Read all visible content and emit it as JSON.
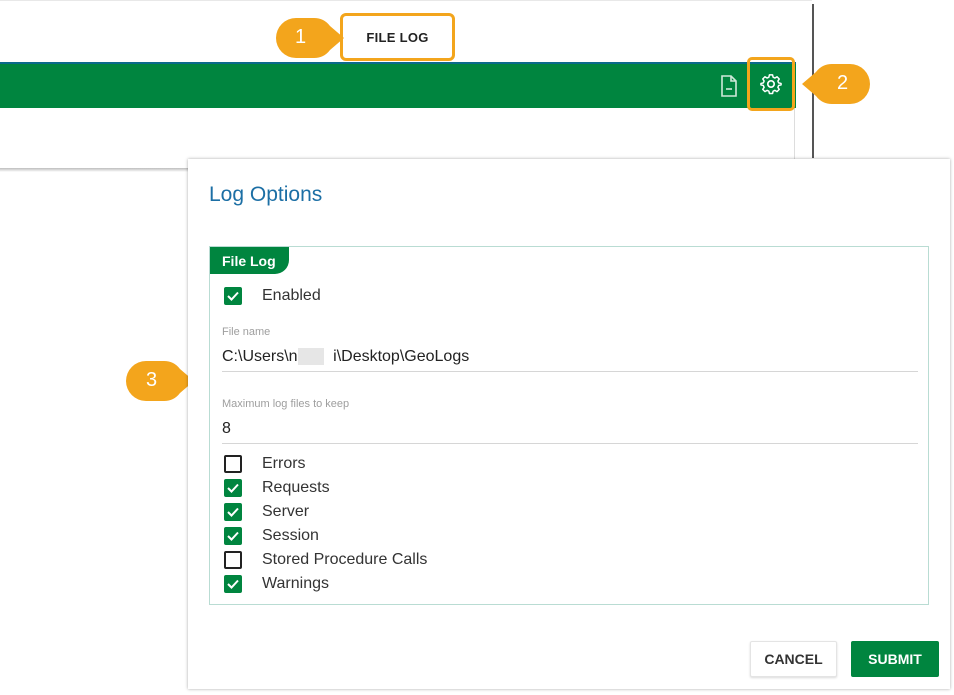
{
  "toolbar": {
    "tab_label": "FILE LOG",
    "doc_icon": "document-icon",
    "settings_icon": "gear-icon",
    "accent_color": "#00853f",
    "highlight_color": "#f3a51c"
  },
  "callouts": [
    "1",
    "2",
    "3"
  ],
  "dialog": {
    "title": "Log Options",
    "section_title": "File Log",
    "enabled": {
      "label": "Enabled",
      "checked": true
    },
    "file_name": {
      "label": "File name",
      "value": "C:\\Users\\n        i\\Desktop\\GeoLogs"
    },
    "max_files": {
      "label": "Maximum log files to keep",
      "value": "8"
    },
    "options": [
      {
        "label": "Errors",
        "checked": false
      },
      {
        "label": "Requests",
        "checked": true
      },
      {
        "label": "Server",
        "checked": true
      },
      {
        "label": "Session",
        "checked": true
      },
      {
        "label": "Stored Procedure Calls",
        "checked": false
      },
      {
        "label": "Warnings",
        "checked": true
      }
    ],
    "cancel_label": "CANCEL",
    "submit_label": "SUBMIT"
  }
}
